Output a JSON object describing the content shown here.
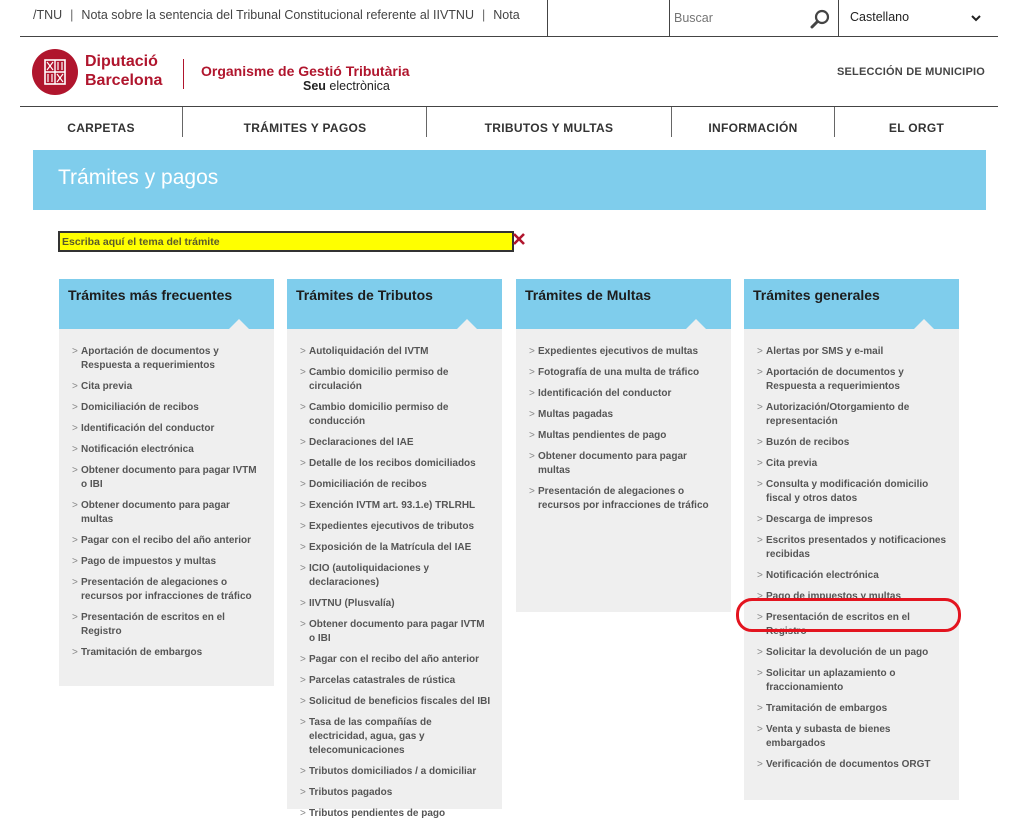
{
  "topbar": {
    "ticker_items": [
      "/TNU",
      "Nota sobre la sentencia del Tribunal Constitucional referente al IIVTNU",
      "Nota"
    ],
    "search_placeholder": "Buscar",
    "language": "Castellano"
  },
  "header": {
    "logo_line1": "Diputació",
    "logo_line2": "Barcelona",
    "org_name": "Organisme de Gestió Tributària",
    "seu_bold": "Seu",
    "seu_rest": " electrònica",
    "municipio_link": "SELECCIÓN DE MUNICIPIO"
  },
  "nav": [
    "CARPETAS",
    "TRÁMITES Y PAGOS",
    "TRIBUTOS Y MULTAS",
    "INFORMACIÓN",
    "EL ORGT"
  ],
  "page": {
    "title": "Trámites y pagos",
    "filter_placeholder": "Escriba aquí el tema del trámite"
  },
  "cards": [
    {
      "title": "Trámites más frecuentes",
      "items": [
        "Aportación de documentos y Respuesta a requerimientos",
        "Cita previa",
        "Domiciliación de recibos",
        "Identificación del conductor",
        "Notificación electrónica",
        "Obtener documento para pagar IVTM o IBI",
        "Obtener documento para pagar multas",
        "Pagar con el recibo del año anterior",
        "Pago de impuestos y multas",
        "Presentación de alegaciones o recursos por infracciones de tráfico",
        "Presentación de escritos en el Registro",
        "Tramitación de embargos"
      ]
    },
    {
      "title": "Trámites de Tributos",
      "items": [
        "Autoliquidación del IVTM",
        "Cambio domicilio permiso de circulación",
        "Cambio domicilio permiso de conducción",
        "Declaraciones del IAE",
        "Detalle de los recibos domiciliados",
        "Domiciliación de recibos",
        "Exención IVTM art. 93.1.e) TRLRHL",
        "Expedientes ejecutivos de tributos",
        "Exposición de la Matrícula del IAE",
        "ICIO (autoliquidaciones y declaraciones)",
        "IIVTNU (Plusvalía)",
        "Obtener documento para pagar IVTM o IBI",
        "Pagar con el recibo del año anterior",
        "Parcelas catastrales de rústica",
        "Solicitud de beneficios fiscales del IBI",
        "Tasa de las compañías de electricidad, agua, gas y telecomunicaciones",
        "Tributos domiciliados / a domiciliar",
        "Tributos pagados",
        "Tributos pendientes de pago"
      ]
    },
    {
      "title": "Trámites de Multas",
      "items": [
        "Expedientes ejecutivos de multas",
        "Fotografía de una multa de tráfico",
        "Identificación del conductor",
        "Multas pagadas",
        "Multas pendientes de pago",
        "Obtener documento para pagar multas",
        "Presentación de alegaciones o recursos por infracciones de tráfico"
      ]
    },
    {
      "title": "Trámites generales",
      "items": [
        "Alertas por SMS y e-mail",
        "Aportación de documentos y Respuesta a requerimientos",
        "Autorización/Otorgamiento de representación",
        "Buzón de recibos",
        "Cita previa",
        "Consulta y modificación domicilio fiscal y otros datos",
        "Descarga de impresos",
        "Escritos presentados y notificaciones recibidas",
        "Notificación electrónica",
        "Pago de impuestos y multas",
        "Presentación de escritos en el Registro",
        "Solicitar la devolución de un pago",
        "Solicitar un aplazamiento o fraccionamiento",
        "Tramitación de embargos",
        "Venta y subasta de bienes embargados",
        "Verificación de documentos ORGT"
      ]
    }
  ],
  "colors": {
    "brand_red": "#b0152d",
    "banner_blue": "#7fcdec",
    "filter_yellow": "#ffff00",
    "highlight_red": "#e3141f"
  }
}
